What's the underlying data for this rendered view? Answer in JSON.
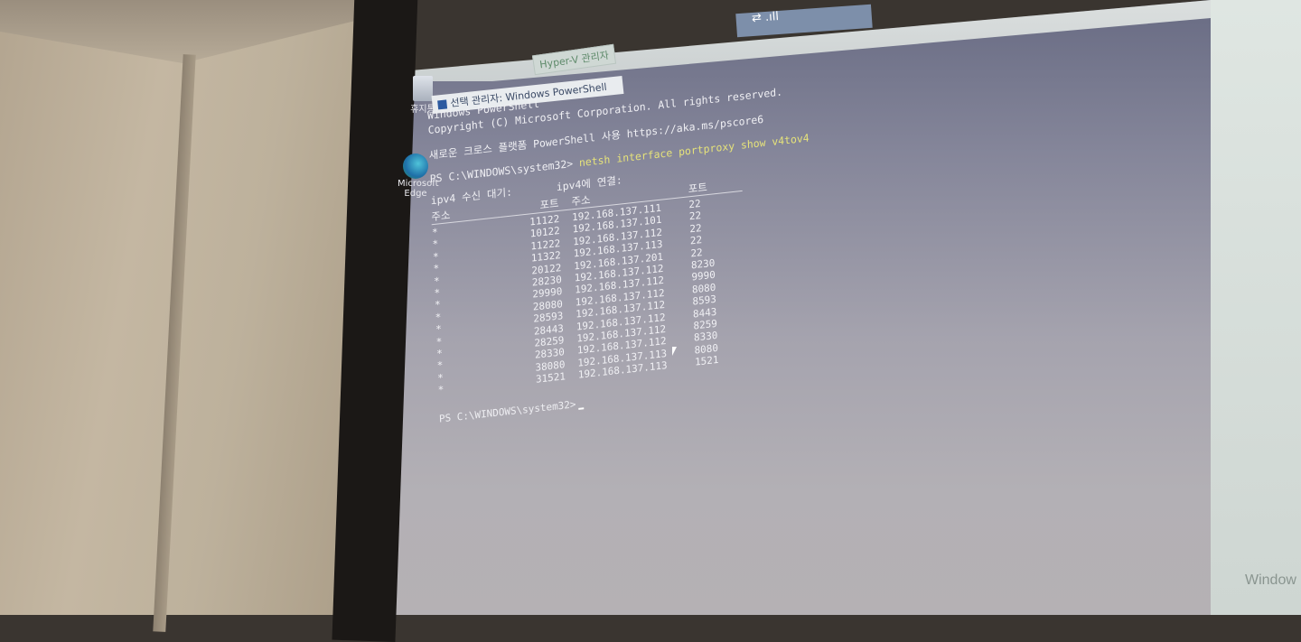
{
  "taskbar": {
    "tray": "⇄ .ıll"
  },
  "windows": {
    "hyperv_tab": "Hyper-V 관리자",
    "powershell_title": "선택 관리자: Windows PowerShell"
  },
  "desktop": {
    "recycle_bin_label": "휴지통",
    "edge_label": "Microsoft Edge"
  },
  "terminal": {
    "banner_line1": "Windows PowerShell",
    "banner_line2": "Copyright (C) Microsoft Corporation. All rights reserved.",
    "banner_line3": "새로운 크로스 플랫폼 PowerShell 사용 https://aka.ms/pscore6",
    "prompt": "PS C:\\WINDOWS\\system32>",
    "command": "netsh interface portproxy show v4tov4",
    "listen_heading": "ipv4 수신 대기:",
    "connect_heading": "ipv4에 연결:",
    "col_address": "주소",
    "col_port": "포트",
    "col_address2": "주소",
    "col_port2": "포트",
    "rows": [
      {
        "addr": "*",
        "lport": "11122",
        "caddr": "192.168.137.111",
        "cport": "22"
      },
      {
        "addr": "*",
        "lport": "10122",
        "caddr": "192.168.137.101",
        "cport": "22"
      },
      {
        "addr": "*",
        "lport": "11222",
        "caddr": "192.168.137.112",
        "cport": "22"
      },
      {
        "addr": "*",
        "lport": "11322",
        "caddr": "192.168.137.113",
        "cport": "22"
      },
      {
        "addr": "*",
        "lport": "20122",
        "caddr": "192.168.137.201",
        "cport": "22"
      },
      {
        "addr": "*",
        "lport": "28230",
        "caddr": "192.168.137.112",
        "cport": "8230"
      },
      {
        "addr": "*",
        "lport": "29990",
        "caddr": "192.168.137.112",
        "cport": "9990"
      },
      {
        "addr": "*",
        "lport": "28080",
        "caddr": "192.168.137.112",
        "cport": "8080"
      },
      {
        "addr": "*",
        "lport": "28593",
        "caddr": "192.168.137.112",
        "cport": "8593"
      },
      {
        "addr": "*",
        "lport": "28443",
        "caddr": "192.168.137.112",
        "cport": "8443"
      },
      {
        "addr": "*",
        "lport": "28259",
        "caddr": "192.168.137.112",
        "cport": "8259"
      },
      {
        "addr": "*",
        "lport": "28330",
        "caddr": "192.168.137.112",
        "cport": "8330"
      },
      {
        "addr": "*",
        "lport": "38080",
        "caddr": "192.168.137.113",
        "cport": "8080"
      },
      {
        "addr": "*",
        "lport": "31521",
        "caddr": "192.168.137.113",
        "cport": "1521"
      }
    ],
    "final_prompt": "PS C:\\WINDOWS\\system32>"
  },
  "background": {
    "watermark": "Window"
  }
}
